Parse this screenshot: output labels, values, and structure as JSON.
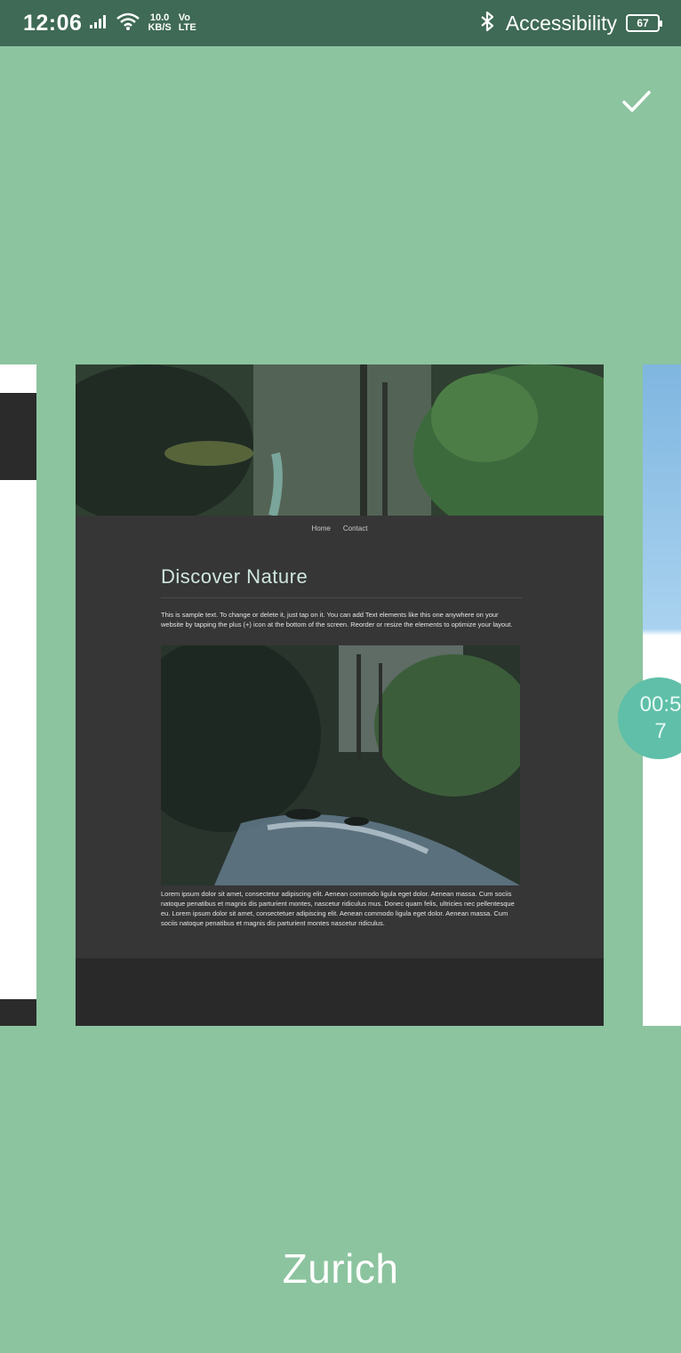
{
  "status_bar": {
    "time": "12:06",
    "net_speed_top": "10.0",
    "net_speed_bottom": "KB/S",
    "volte_top": "Vo",
    "volte_bottom": "LTE",
    "accessibility_label": "Accessibility",
    "battery": "67",
    "icons": [
      "signal-icon",
      "wifi-icon",
      "bluetooth-icon",
      "battery-icon"
    ]
  },
  "toolbar": {
    "confirm_icon": "check-icon"
  },
  "template_preview": {
    "nav_items": [
      "Home",
      "Contact"
    ],
    "title": "Discover Nature",
    "paragraph1": "This is sample text. To change or delete it, just tap on it. You can add Text elements like this one anywhere on your website by tapping the plus (+) icon at the bottom of the screen. Reorder or resize the elements to optimize your layout.",
    "paragraph2": "Lorem ipsum dolor sit amet, consectetur adipiscing elit. Aenean commodo ligula eget dolor. Aenean massa. Cum sociis natoque penatibus et magnis dis parturient montes, nascetur ridiculus mus. Donec quam felis, ultricies nec pellentesque eu. Lorem ipsum dolor sit amet, consectetuer adipiscing elit. Aenean commodo ligula eget dolor. Aenean massa. Cum sociis natoque penatibus et magnis dis parturient montes nascetur ridiculus."
  },
  "timer": {
    "value": "00:57"
  },
  "location": {
    "label": "Zurich"
  },
  "colors": {
    "background": "#8cc49f",
    "status_bar": "#3f6a55",
    "card_dark": "#363636",
    "timer_badge": "#5fbfa8"
  }
}
